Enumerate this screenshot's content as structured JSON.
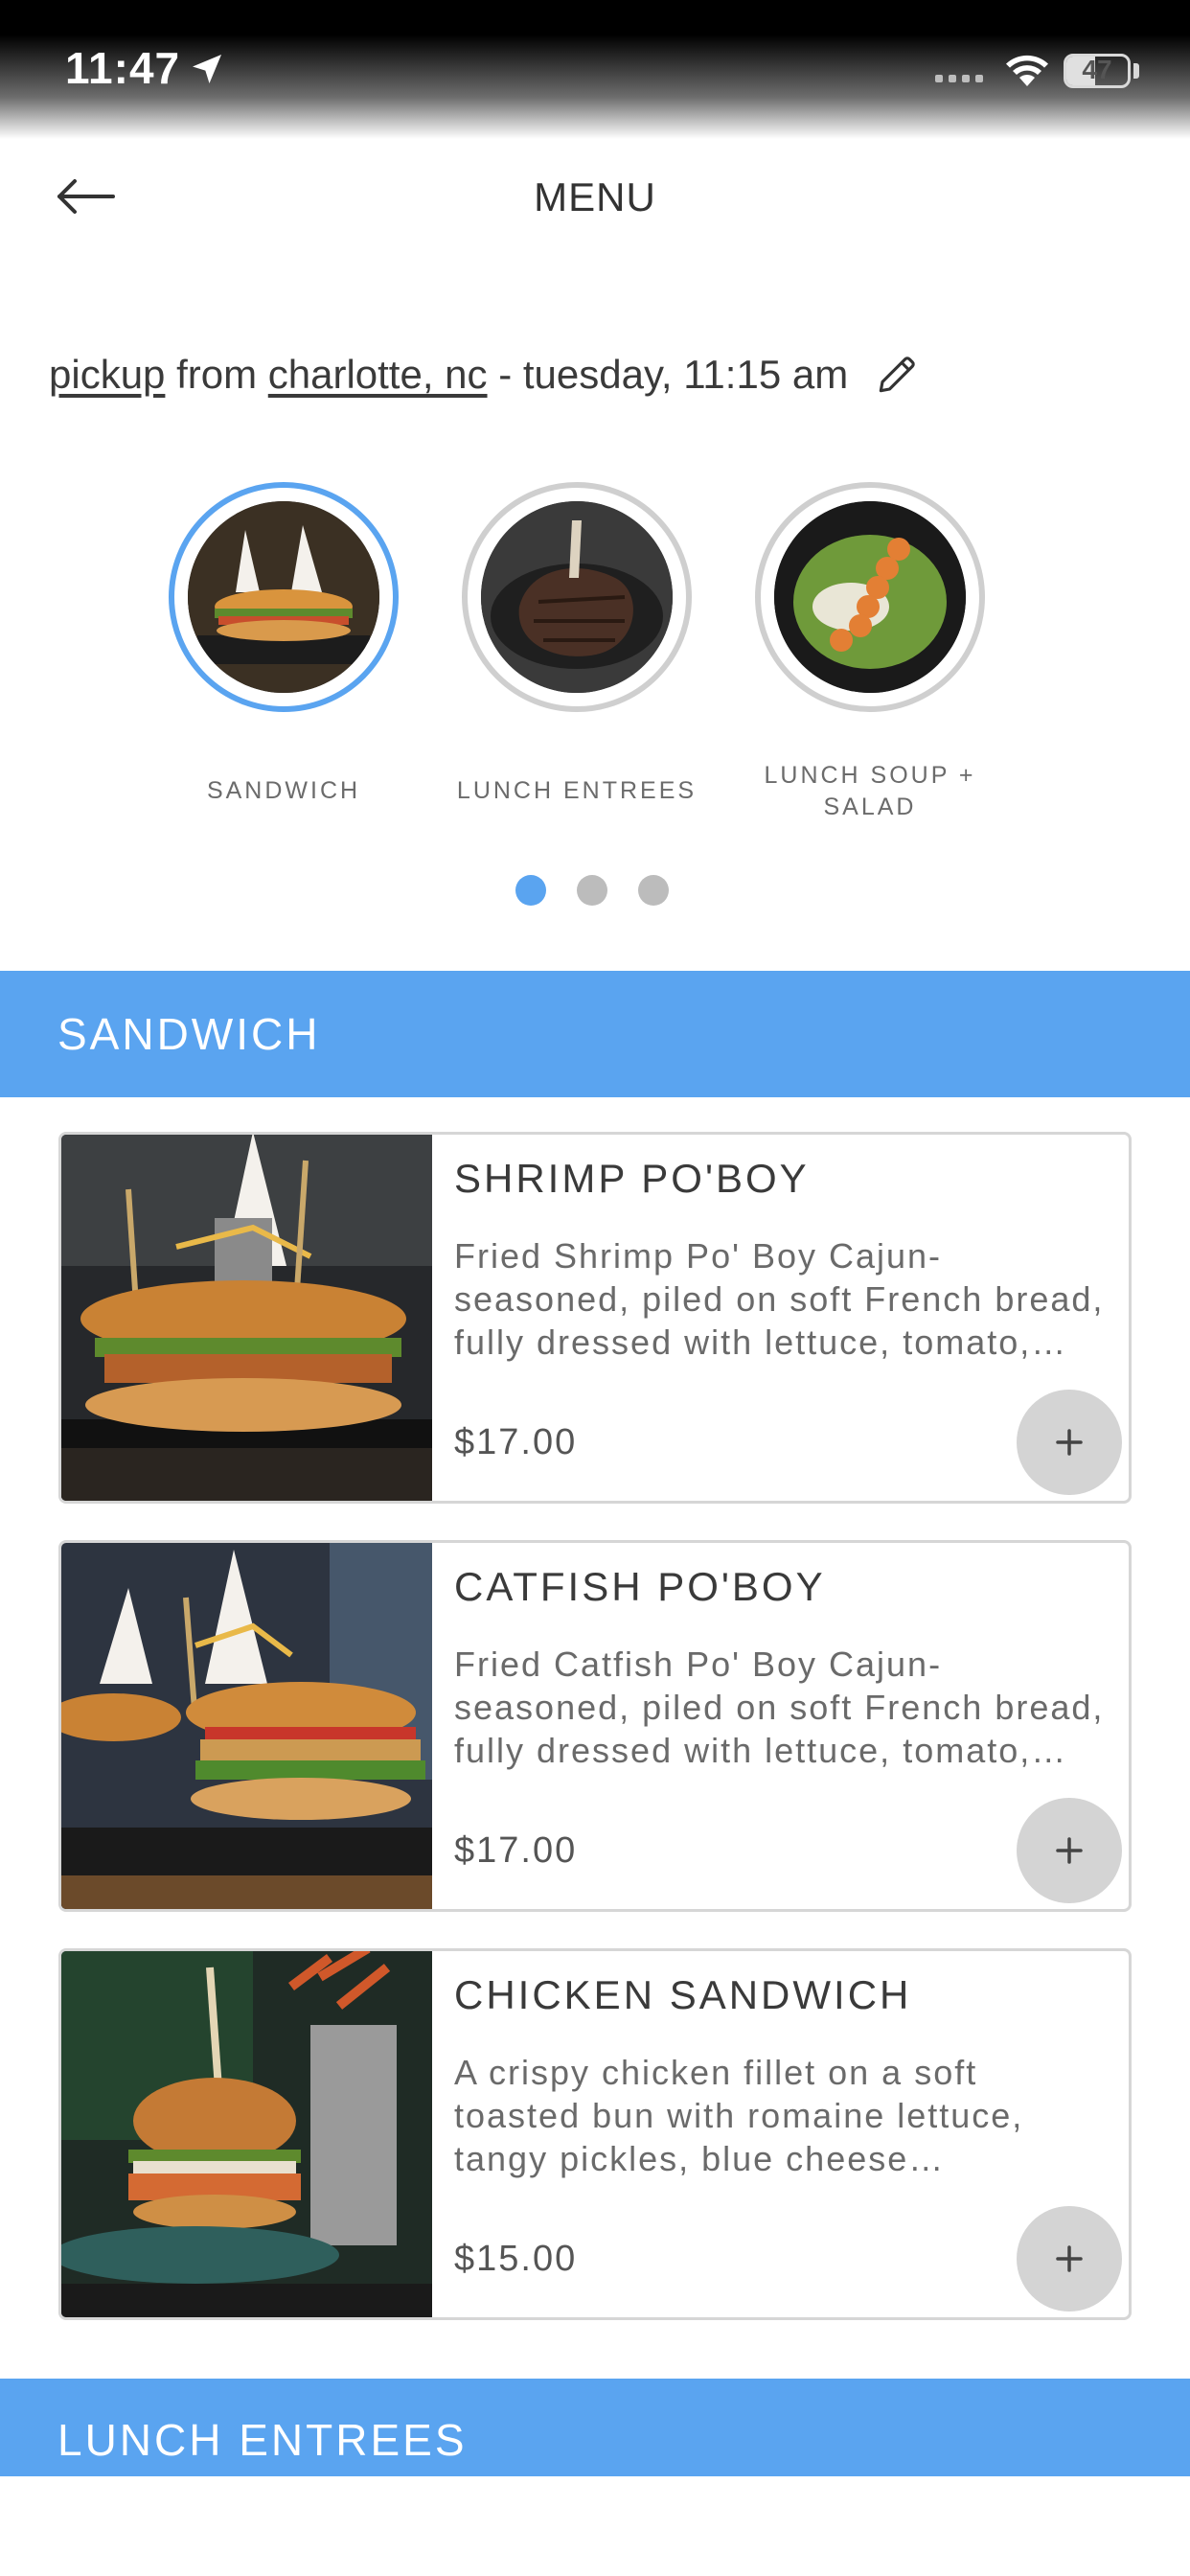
{
  "status_bar": {
    "time": "11:47",
    "battery": "47",
    "battery_level": 0.47
  },
  "header": {
    "title": "MENU"
  },
  "pickup": {
    "mode": "pickup",
    "from_text": " from ",
    "location": "charlotte, nc",
    "time_text": " - tuesday, 11:15 am"
  },
  "categories": [
    {
      "label": "SANDWICH",
      "active": true
    },
    {
      "label": "LUNCH ENTREES",
      "active": false
    },
    {
      "label": "LUNCH SOUP + SALAD",
      "active": false
    }
  ],
  "carousel": {
    "page_count": 3,
    "active_index": 0
  },
  "sections": [
    {
      "title": "SANDWICH"
    },
    {
      "title": "LUNCH ENTREES"
    }
  ],
  "items": [
    {
      "name": "SHRIMP PO'BOY",
      "description": "Fried Shrimp Po' Boy Cajun-seasoned, piled on soft French bread, fully dressed with lettuce, tomato, pickles…",
      "price": "$17.00"
    },
    {
      "name": "CATFISH PO'BOY",
      "description": "Fried Catfish Po' Boy Cajun-seasoned, piled on soft French bread, fully dressed with lettuce, tomato, pickles…",
      "price": "$17.00"
    },
    {
      "name": "CHICKEN SANDWICH",
      "description": "A crispy chicken fillet on a soft toasted bun with romaine lettuce, tangy pickles, blue cheese crumbles,…",
      "price": "$15.00"
    }
  ],
  "colors": {
    "accent": "#5aa4f0",
    "inactive_dot": "#bcbcbc",
    "add_button": "#d4d4d4"
  }
}
